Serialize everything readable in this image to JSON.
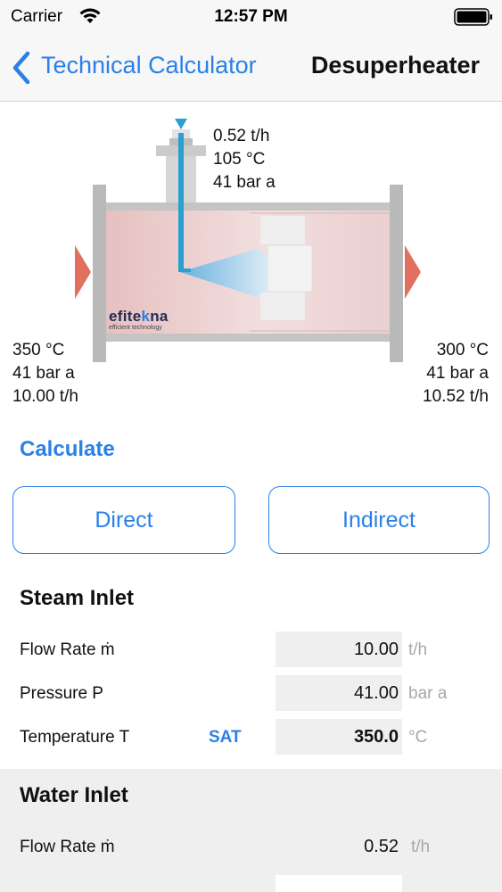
{
  "status_bar": {
    "carrier": "Carrier",
    "time": "12:57 PM",
    "icons": [
      "wifi-icon",
      "battery-icon"
    ]
  },
  "nav": {
    "back_label": "Technical Calculator",
    "title": "Desuperheater",
    "back_icon": "chevron-left-icon"
  },
  "diagram": {
    "water_in": {
      "flow": "0.52 t/h",
      "temperature": "105 °C",
      "pressure": "41 bar a"
    },
    "steam_in": {
      "temperature": "350 °C",
      "pressure": "41 bar a",
      "flow": "10.00 t/h"
    },
    "steam_out": {
      "temperature": "300 °C",
      "pressure": "41 bar a",
      "flow": "10.52 t/h"
    },
    "brand": {
      "name_part1": "efite",
      "name_part2": "k",
      "name_part3": "na",
      "tagline": "efficient technology"
    },
    "colors": {
      "pipe_fill": "#e8c4c4",
      "flange": "#b9b9b9",
      "arrow": "#e2705f",
      "water_line": "#2a9fd0"
    }
  },
  "calculate": {
    "title": "Calculate",
    "direct_label": "Direct",
    "indirect_label": "Indirect"
  },
  "steam_inlet": {
    "title": "Steam Inlet",
    "rows": [
      {
        "label": "Flow Rate ṁ",
        "value": "10.00",
        "unit": "t/h"
      },
      {
        "label": "Pressure  P",
        "value": "41.00",
        "unit": "bar a"
      },
      {
        "label": "Temperature  T",
        "value": "350.0",
        "unit": "°C",
        "action": "SAT"
      }
    ]
  },
  "water_inlet": {
    "title": "Water Inlet",
    "rows": [
      {
        "label": "Flow Rate ṁ",
        "value": "0.52",
        "unit": "t/h"
      }
    ]
  },
  "theme": {
    "accent": "#2a80e8",
    "field_bg": "#efefef",
    "unit_gray": "#a8a8a8"
  }
}
